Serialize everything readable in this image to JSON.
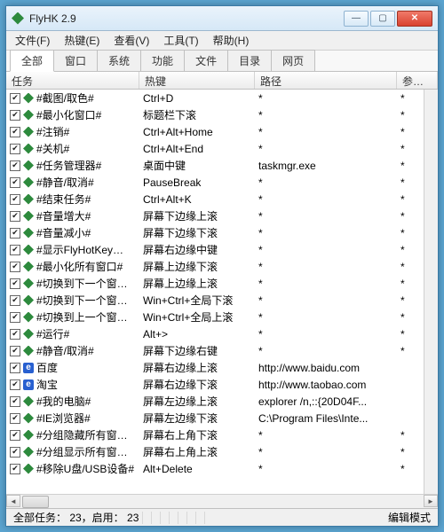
{
  "window": {
    "title": "FlyHK 2.9"
  },
  "menu": [
    "文件(F)",
    "热键(E)",
    "查看(V)",
    "工具(T)",
    "帮助(H)"
  ],
  "tabs": {
    "items": [
      "全部",
      "窗口",
      "系统",
      "功能",
      "文件",
      "目录",
      "网页"
    ],
    "active": 0
  },
  "columns": {
    "task": "任务",
    "hotkey": "热键",
    "path": "路径",
    "param": "参…"
  },
  "rows": [
    {
      "checked": true,
      "icon": "h",
      "task": "#截图/取色#",
      "hotkey": "Ctrl+D",
      "path": "*",
      "param": "*"
    },
    {
      "checked": true,
      "icon": "h",
      "task": "#最小化窗口#",
      "hotkey": "标题栏下滚",
      "path": "*",
      "param": "*"
    },
    {
      "checked": true,
      "icon": "h",
      "task": "#注销#",
      "hotkey": "Ctrl+Alt+Home",
      "path": "*",
      "param": "*"
    },
    {
      "checked": true,
      "icon": "h",
      "task": "#关机#",
      "hotkey": "Ctrl+Alt+End",
      "path": "*",
      "param": "*"
    },
    {
      "checked": true,
      "icon": "h",
      "task": "#任务管理器#",
      "hotkey": "桌面中键",
      "path": "taskmgr.exe",
      "param": "*"
    },
    {
      "checked": true,
      "icon": "h",
      "task": "#静音/取消#",
      "hotkey": "PauseBreak",
      "path": "*",
      "param": "*"
    },
    {
      "checked": true,
      "icon": "h",
      "task": "#结束任务#",
      "hotkey": "Ctrl+Alt+K",
      "path": "*",
      "param": "*"
    },
    {
      "checked": true,
      "icon": "h",
      "task": "#音量增大#",
      "hotkey": "屏幕下边缘上滚",
      "path": "*",
      "param": "*"
    },
    {
      "checked": true,
      "icon": "h",
      "task": "#音量减小#",
      "hotkey": "屏幕下边缘下滚",
      "path": "*",
      "param": "*"
    },
    {
      "checked": true,
      "icon": "h",
      "task": "#显示FlyHotKey…",
      "hotkey": "屏幕右边缘中键",
      "path": "*",
      "param": "*"
    },
    {
      "checked": true,
      "icon": "h",
      "task": "#最小化所有窗口#",
      "hotkey": "屏幕上边缘下滚",
      "path": "*",
      "param": "*"
    },
    {
      "checked": true,
      "icon": "h",
      "task": "#切换到下一个窗…",
      "hotkey": "屏幕上边缘上滚",
      "path": "*",
      "param": "*"
    },
    {
      "checked": true,
      "icon": "h",
      "task": "#切换到下一个窗…",
      "hotkey": "Win+Ctrl+全局下滚",
      "path": "*",
      "param": "*"
    },
    {
      "checked": true,
      "icon": "h",
      "task": "#切换到上一个窗…",
      "hotkey": "Win+Ctrl+全局上滚",
      "path": "*",
      "param": "*"
    },
    {
      "checked": true,
      "icon": "h",
      "task": "#运行#",
      "hotkey": "Alt+>",
      "path": "*",
      "param": "*"
    },
    {
      "checked": true,
      "icon": "h",
      "task": "#静音/取消#",
      "hotkey": "屏幕下边缘右键",
      "path": "*",
      "param": "*"
    },
    {
      "checked": true,
      "icon": "e",
      "task": "百度",
      "hotkey": "屏幕右边缘上滚",
      "path": "http://www.baidu.com",
      "param": ""
    },
    {
      "checked": true,
      "icon": "e",
      "task": "淘宝",
      "hotkey": "屏幕右边缘下滚",
      "path": "http://www.taobao.com",
      "param": ""
    },
    {
      "checked": true,
      "icon": "h",
      "task": "#我的电脑#",
      "hotkey": "屏幕左边缘上滚",
      "path": "explorer /n,::{20D04F...",
      "param": ""
    },
    {
      "checked": true,
      "icon": "h",
      "task": "#IE浏览器#",
      "hotkey": "屏幕左边缘下滚",
      "path": "C:\\Program Files\\Inte...",
      "param": ""
    },
    {
      "checked": true,
      "icon": "h",
      "task": "#分组隐藏所有窗…",
      "hotkey": "屏幕右上角下滚",
      "path": "*",
      "param": "*"
    },
    {
      "checked": true,
      "icon": "h",
      "task": "#分组显示所有窗…",
      "hotkey": "屏幕右上角上滚",
      "path": "*",
      "param": "*"
    },
    {
      "checked": true,
      "icon": "h",
      "task": "#移除U盘/USB设备#",
      "hotkey": "Alt+Delete",
      "path": "*",
      "param": "*"
    }
  ],
  "status": {
    "left": "全部任务： 23，启用： 23",
    "right": "编辑模式"
  }
}
